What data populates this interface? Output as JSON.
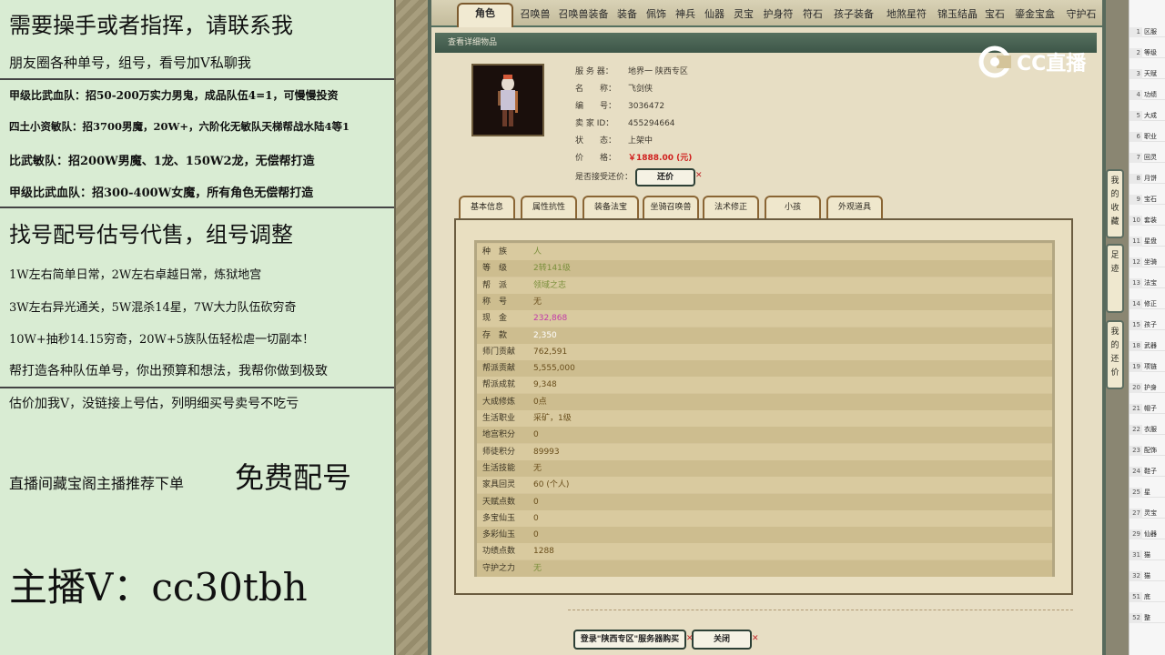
{
  "left_panel": {
    "lines": [
      "需要操手或者指挥，请联系我",
      "朋友圈各种单号，组号，看号加V私聊我",
      "甲级比武血队：招50-200万实力男鬼，成品队伍4=1，可慢慢投资",
      "四土小资敏队：招3700男魔，20W+，六阶化无敏队天梯帮战水陆4等1",
      "比武敏队：招200W男魔、1龙、150W2龙，无偿帮打造",
      "甲级比武血队：招300-400W女魔，所有角色无偿帮打造",
      "找号配号估号代售，组号调整",
      "1W左右简单日常，2W左右卓越日常，炼狱地宫",
      "3W左右异光通关，5W混杀14星，7W大力队伍砍穷奇",
      "10W+抽秒14.15穷奇，20W+5族队伍轻松虐一切副本！",
      "帮打造各种队伍单号，你出预算和想法，我帮你做到极致",
      "估价加我V，没链接上号估，列明细买号卖号不吃亏",
      "直播间藏宝阁主播推荐下单",
      "免费配号",
      "主播V：cc30tbh"
    ]
  },
  "top_tabs": [
    "角色",
    "召唤兽",
    "召唤兽装备",
    "装备",
    "佩饰",
    "神兵",
    "仙器",
    "灵宝",
    "护身符",
    "符石",
    "孩子装备",
    "地煞星符",
    "锦玉结晶",
    "宝石",
    "鎏金宝盒",
    "守护石"
  ],
  "header": {
    "title": "查看详细物品"
  },
  "info": {
    "rows": [
      {
        "k": "服 务 器：",
        "v": "地界一 陕西专区"
      },
      {
        "k": "名　　称：",
        "v": "飞剑侠"
      },
      {
        "k": "编　　号：",
        "v": "3036472"
      },
      {
        "k": "卖 家 ID：",
        "v": "455294664"
      },
      {
        "k": "状　　态：",
        "v": "上架中"
      },
      {
        "k": "价　　格：",
        "v": "￥1888.00 (元)"
      },
      {
        "k": "是否接受还价：",
        "v": ""
      }
    ],
    "bargain_label": "还价"
  },
  "sub_tabs": [
    "基本信息",
    "属性抗性",
    "装备法宝",
    "坐骑召唤兽",
    "法术修正",
    "小孩",
    "外观道具"
  ],
  "details": [
    {
      "k": "种　族",
      "v": "人",
      "color": "#7a8f3b"
    },
    {
      "k": "等　级",
      "v": "2转141级",
      "color": "#7a8f3b"
    },
    {
      "k": "帮　派",
      "v": "领域之志",
      "color": "#7a8f3b"
    },
    {
      "k": "称　号",
      "v": "无",
      "color": "#6a4f1c"
    },
    {
      "k": "现　金",
      "v": "232,868",
      "color": "#c23aa8"
    },
    {
      "k": "存　款",
      "v": "2,350",
      "color": "#ffffff"
    },
    {
      "k": "师门贡献",
      "v": "762,591",
      "color": "#6a4f1c"
    },
    {
      "k": "帮派贡献",
      "v": "5,555,000",
      "color": "#6a4f1c"
    },
    {
      "k": "帮派成就",
      "v": "9,348",
      "color": "#6a4f1c"
    },
    {
      "k": "大成修炼",
      "v": "0点",
      "color": "#6a4f1c"
    },
    {
      "k": "生活职业",
      "v": "采矿，1级",
      "color": "#6a4f1c"
    },
    {
      "k": "地宫积分",
      "v": "0",
      "color": "#6a4f1c"
    },
    {
      "k": "师徒积分",
      "v": "89993",
      "color": "#6a4f1c"
    },
    {
      "k": "生活技能",
      "v": "无",
      "color": "#6a4f1c"
    },
    {
      "k": "家具回灵",
      "v": "60 (个人)",
      "color": "#6a4f1c"
    },
    {
      "k": "天赋点数",
      "v": "0",
      "color": "#6a4f1c"
    },
    {
      "k": "多宝仙玉",
      "v": "0",
      "color": "#6a4f1c"
    },
    {
      "k": "多彩仙玉",
      "v": "0",
      "color": "#6a4f1c"
    },
    {
      "k": "功绩点数",
      "v": "1288",
      "color": "#6a4f1c"
    },
    {
      "k": "守护之力",
      "v": "无",
      "color": "#7a8f3b"
    }
  ],
  "buttons": {
    "buy": "登录\"陕西专区\"服务器购买",
    "close": "关闭"
  },
  "side_tabs": [
    "我的收藏",
    "足迹",
    "我的还价"
  ],
  "logo": {
    "text": "CC直播"
  },
  "sheet": {
    "rows": [
      {
        "n": "1",
        "t": "区服"
      },
      {
        "n": "2",
        "t": "等级"
      },
      {
        "n": "3",
        "t": "天赋"
      },
      {
        "n": "4",
        "t": "功绩"
      },
      {
        "n": "5",
        "t": "大成"
      },
      {
        "n": "6",
        "t": "职业"
      },
      {
        "n": "7",
        "t": "回灵"
      },
      {
        "n": "8",
        "t": "月饼"
      },
      {
        "n": "9",
        "t": "宝石"
      },
      {
        "n": "10",
        "t": "套装"
      },
      {
        "n": "11",
        "t": "星盘"
      },
      {
        "n": "12",
        "t": "坐骑"
      },
      {
        "n": "13",
        "t": "法宝"
      },
      {
        "n": "14",
        "t": "修正"
      },
      {
        "n": "15",
        "t": "孩子"
      },
      {
        "n": "18",
        "t": "武器"
      },
      {
        "n": "19",
        "t": "项链"
      },
      {
        "n": "20",
        "t": "护身"
      },
      {
        "n": "21",
        "t": "帽子"
      },
      {
        "n": "22",
        "t": "衣服"
      },
      {
        "n": "23",
        "t": "配饰"
      },
      {
        "n": "24",
        "t": "鞋子"
      },
      {
        "n": "25",
        "t": "星"
      },
      {
        "n": "27",
        "t": "灵宝"
      },
      {
        "n": "29",
        "t": "仙器"
      },
      {
        "n": "31",
        "t": "猫"
      },
      {
        "n": "32",
        "t": "猫"
      },
      {
        "n": "51",
        "t": "底"
      },
      {
        "n": "52",
        "t": "整"
      }
    ]
  }
}
